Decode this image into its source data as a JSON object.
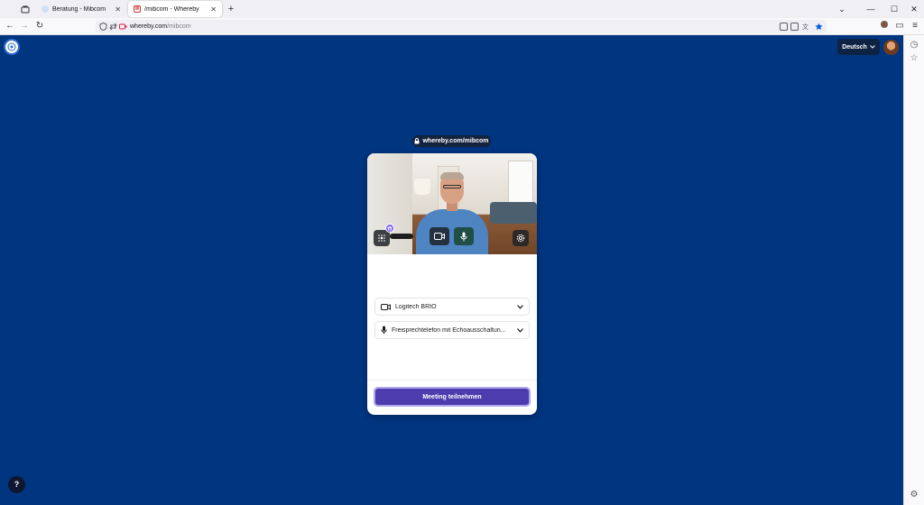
{
  "browser": {
    "tabs": [
      {
        "title": "Beratung - Mibcom",
        "active": false
      },
      {
        "title": "/mibcom - Whereby",
        "active": true
      }
    ],
    "url": {
      "host": "whereby.com",
      "path": "/mibcom"
    }
  },
  "header": {
    "language_label": "Deutsch"
  },
  "room": {
    "address": "whereby.com/mibcom"
  },
  "preview": {
    "camera_device": "Logitech BRIO",
    "microphone_device": "Freisprechtelefon mit Echoausschaltun..."
  },
  "join": {
    "label": "Meeting teilnehmen"
  },
  "help": {
    "label": "?"
  },
  "colors": {
    "page_background": "#003580",
    "join_button": "#4c3cae",
    "mic_active": "#1f4f46"
  }
}
